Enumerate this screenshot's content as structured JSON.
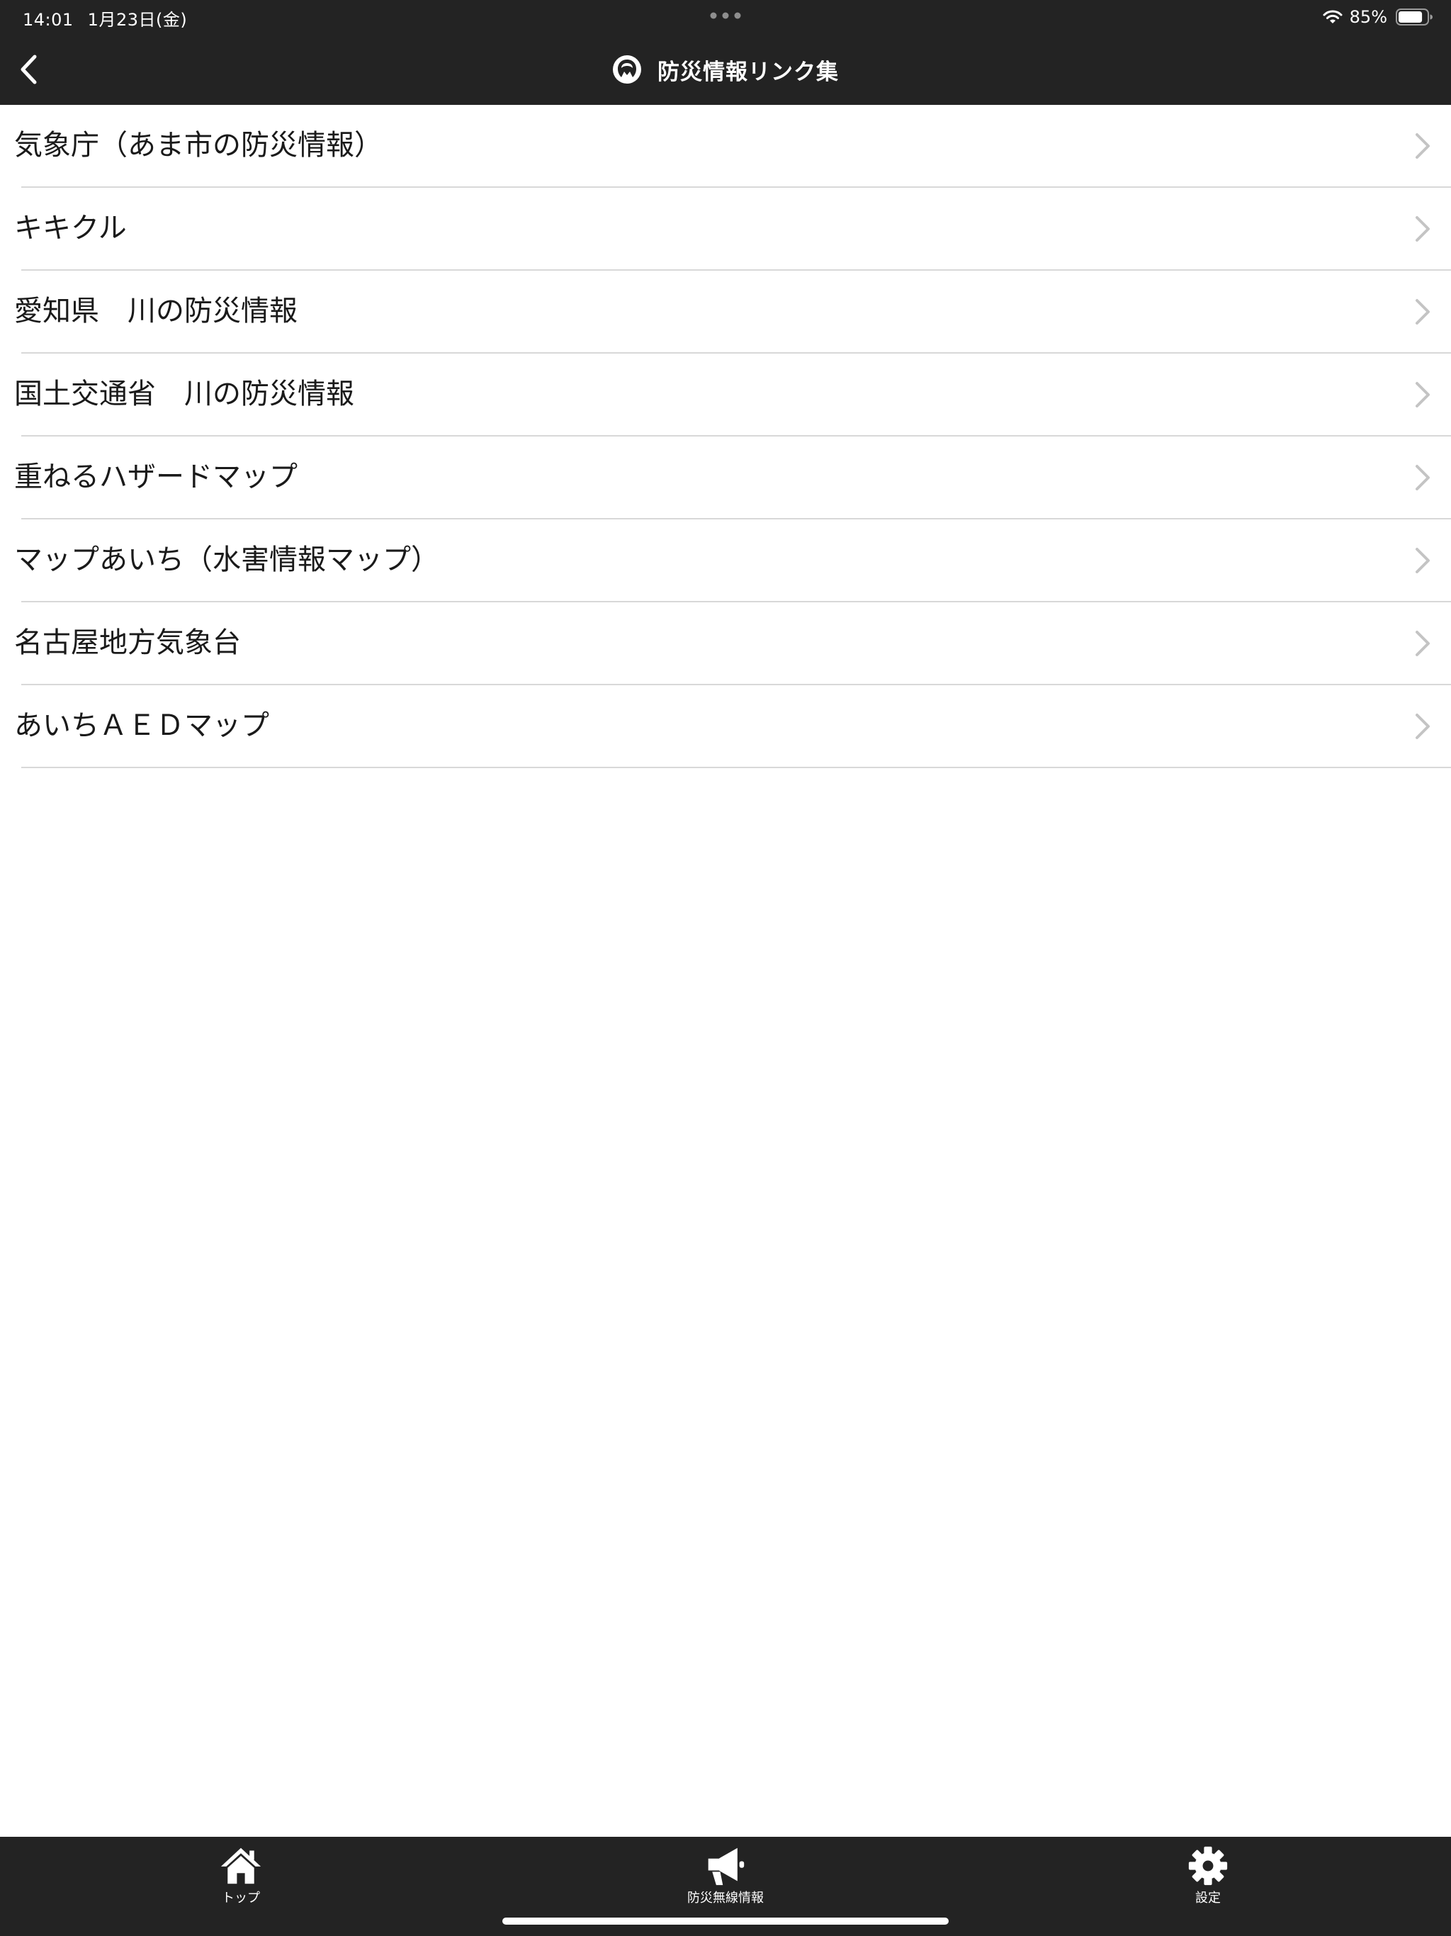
{
  "status_bar": {
    "time": "14:01",
    "date": "1月23日(金)",
    "battery_percent": "85%",
    "battery_level": 0.85
  },
  "nav": {
    "title": "防災情報リンク集",
    "back_icon": "chevron-left-icon",
    "logo_icon": "city-emblem-icon"
  },
  "links": [
    {
      "label": "気象庁（あま市の防災情報）"
    },
    {
      "label": "キキクル"
    },
    {
      "label": "愛知県　川の防災情報"
    },
    {
      "label": "国土交通省　川の防災情報"
    },
    {
      "label": "重ねるハザードマップ"
    },
    {
      "label": "マップあいち（水害情報マップ）"
    },
    {
      "label": "名古屋地方気象台"
    },
    {
      "label": "あいちＡＥＤマップ"
    }
  ],
  "tabbar": {
    "tabs": [
      {
        "label": "トップ",
        "icon": "home-icon"
      },
      {
        "label": "防災無線情報",
        "icon": "megaphone-icon"
      },
      {
        "label": "設定",
        "icon": "gear-icon"
      }
    ]
  },
  "colors": {
    "bar_background": "#232323",
    "list_background": "#ffffff",
    "separator": "#d8d8d8",
    "chevron": "#c4c4c4"
  }
}
